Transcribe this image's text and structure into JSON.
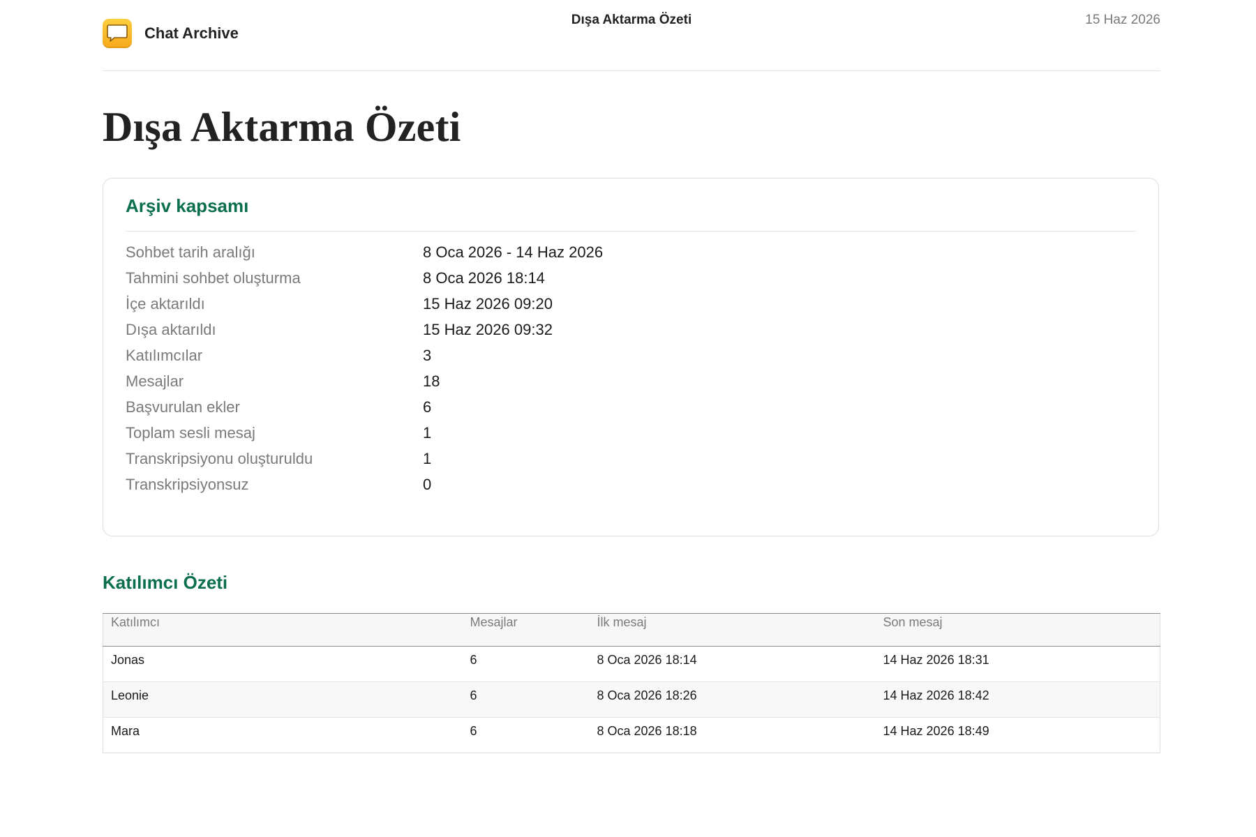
{
  "header": {
    "app_name": "Chat Archive",
    "app_icon": "chat-bubble-icon",
    "title": "Dışa Aktarma Özeti",
    "date": "15 Haz 2026"
  },
  "main": {
    "title": "Dışa Aktarma Özeti"
  },
  "scope": {
    "title": "Arşiv kapsamı",
    "rows": [
      {
        "label": "Sohbet tarih aralığı",
        "value": "8 Oca 2026 - 14 Haz 2026"
      },
      {
        "label": "Tahmini sohbet oluşturma",
        "value": "8 Oca 2026 18:14"
      },
      {
        "label": "İçe aktarıldı",
        "value": "15 Haz 2026 09:20"
      },
      {
        "label": "Dışa aktarıldı",
        "value": "15 Haz 2026 09:32"
      },
      {
        "label": "Katılımcılar",
        "value": "3"
      },
      {
        "label": "Mesajlar",
        "value": "18"
      },
      {
        "label": "Başvurulan ekler",
        "value": "6"
      },
      {
        "label": "Toplam sesli mesaj",
        "value": "1"
      },
      {
        "label": "Transkripsiyonu oluşturuldu",
        "value": "1"
      },
      {
        "label": "Transkripsiyonsuz",
        "value": "0"
      }
    ]
  },
  "participants": {
    "title": "Katılımcı Özeti",
    "columns": [
      "Katılımcı",
      "Mesajlar",
      "İlk mesaj",
      "Son mesaj"
    ],
    "rows": [
      [
        "Jonas",
        "6",
        "8 Oca 2026 18:14",
        "14 Haz 2026 18:31"
      ],
      [
        "Leonie",
        "6",
        "8 Oca 2026 18:26",
        "14 Haz 2026 18:42"
      ],
      [
        "Mara",
        "6",
        "8 Oca 2026 18:18",
        "14 Haz 2026 18:49"
      ]
    ]
  },
  "colors": {
    "accent": "#0b6e4f",
    "icon_yellow": "#f7a81b",
    "muted_text": "#7a7a7a"
  }
}
